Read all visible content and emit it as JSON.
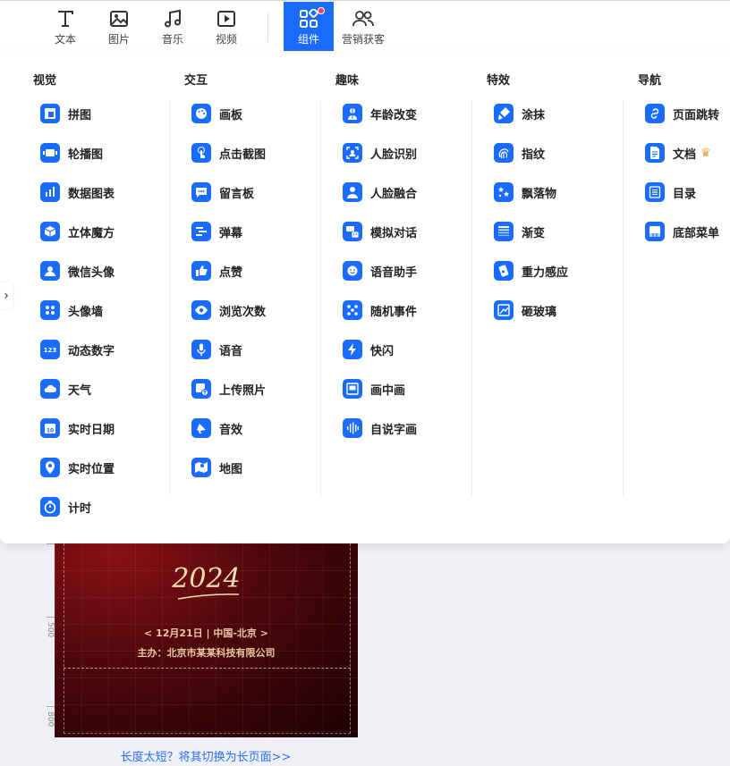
{
  "toolbar": {
    "items": [
      {
        "label": "文本",
        "icon": "text-icon"
      },
      {
        "label": "图片",
        "icon": "image-icon"
      },
      {
        "label": "音乐",
        "icon": "music-icon"
      },
      {
        "label": "视频",
        "icon": "video-icon"
      },
      {
        "label": "组件",
        "icon": "components-icon",
        "active": true
      },
      {
        "label": "营销获客",
        "icon": "users-icon"
      }
    ]
  },
  "panel": {
    "columns": [
      {
        "title": "视觉",
        "items": [
          "拼图",
          "轮播图",
          "数据图表",
          "立体魔方",
          "微信头像",
          "头像墙",
          "动态数字",
          "天气",
          "实时日期",
          "实时位置",
          "计时"
        ]
      },
      {
        "title": "交互",
        "items": [
          "画板",
          "点击截图",
          "留言板",
          "弹幕",
          "点赞",
          "浏览次数",
          "语音",
          "上传照片",
          "音效",
          "地图"
        ]
      },
      {
        "title": "趣味",
        "items": [
          "年龄改变",
          "人脸识别",
          "人脸融合",
          "模拟对话",
          "语音助手",
          "随机事件",
          "快闪",
          "画中画",
          "自说字画"
        ]
      },
      {
        "title": "特效",
        "items": [
          "涂抹",
          "指纹",
          "飘落物",
          "渐变",
          "重力感应",
          "砸玻璃"
        ]
      },
      {
        "title": "导航",
        "items": [
          "页面跳转",
          "文档",
          "目录",
          "底部菜单"
        ]
      }
    ]
  },
  "canvas": {
    "year": "2024",
    "date_line": "< 12月21日 | 中国-北京 >",
    "organizer_line": "主办：北京市某某科技有限公司",
    "ruler_labels": [
      "500",
      "800"
    ]
  },
  "footer": {
    "switch_link": "长度太短？将其切换为长页面>>"
  },
  "colors": {
    "accent": "#1a6bff",
    "link": "#2a6ef0",
    "background": "#eef0f6"
  }
}
